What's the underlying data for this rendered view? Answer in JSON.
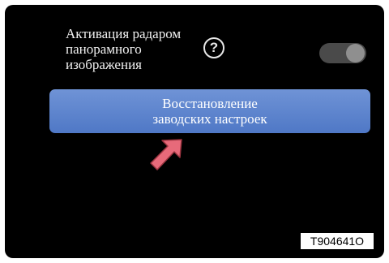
{
  "panorama_setting": {
    "label_lines": [
      "Активация радаром",
      "панорамного",
      "изображения"
    ],
    "help_icon": "question-circle-icon",
    "toggle_state": "on"
  },
  "reset_button": {
    "label_lines": [
      "Восстановление",
      "заводских настроек"
    ]
  },
  "pointer": {
    "icon": "pointer-arrow-icon"
  },
  "figure_code": "T904641O",
  "colors": {
    "screen_bg": "#000000",
    "button_blue": "#5a82cc",
    "toggle_track": "#4a4a4a",
    "toggle_knob": "#8f8f8f",
    "arrow_fill": "#e76a7a"
  }
}
